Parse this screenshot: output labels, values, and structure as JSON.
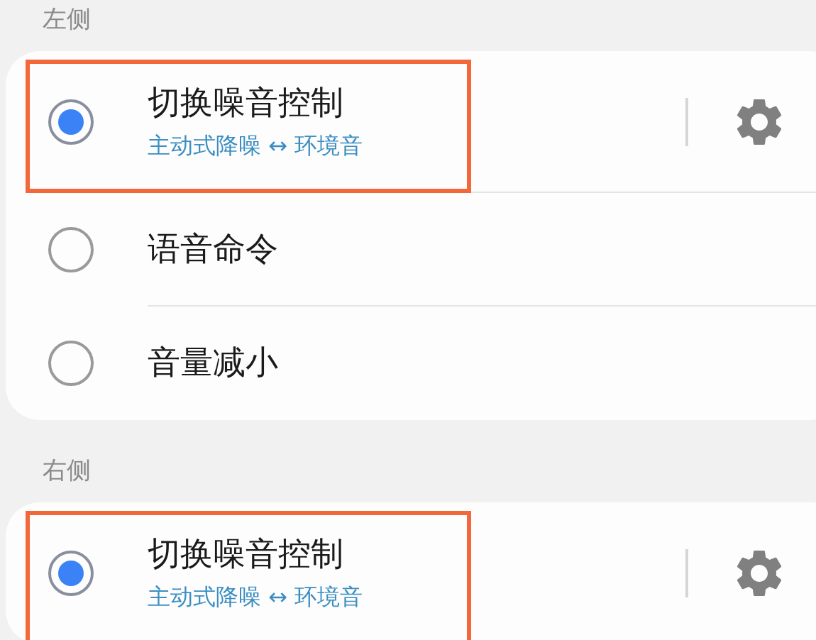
{
  "sections": [
    {
      "header": "左侧",
      "options": [
        {
          "title": "切换噪音控制",
          "subtitle": "主动式降噪 ↔ 环境音",
          "selected": true,
          "highlighted": true,
          "has_settings": true
        },
        {
          "title": "语音命令",
          "selected": false,
          "highlighted": false,
          "has_settings": false
        },
        {
          "title": "音量减小",
          "selected": false,
          "highlighted": false,
          "has_settings": false
        }
      ]
    },
    {
      "header": "右侧",
      "options": [
        {
          "title": "切换噪音控制",
          "subtitle": "主动式降噪 ↔ 环境音",
          "selected": true,
          "highlighted": true,
          "has_settings": true
        }
      ]
    }
  ]
}
